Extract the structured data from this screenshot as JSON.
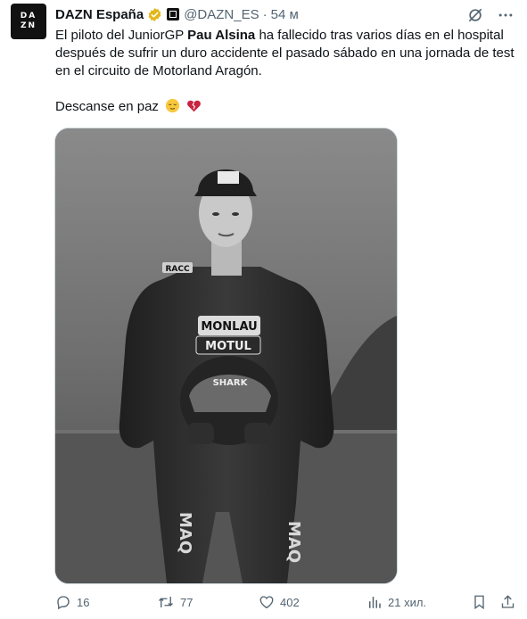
{
  "author": {
    "name": "DAZN España",
    "handle": "@DAZN_ES",
    "time": "54 м",
    "avatar_text": [
      "DA",
      "ZN"
    ]
  },
  "tweet": {
    "p1_a": "El piloto del JuniorGP ",
    "p1_bold": "Pau Alsina",
    "p1_b": " ha fallecido tras varios días en el hospital después de sufrir un duro accidente el pasado sábado en una jornada de test en el circuito de Motorland Aragón.",
    "p2": "Descanse en paz"
  },
  "media": {
    "sponsors": [
      "MONLAU",
      "MOTUL",
      "SHARK",
      "RACC",
      "MAQ"
    ]
  },
  "actions": {
    "replies": "16",
    "retweets": "77",
    "likes": "402",
    "views": "21 хил."
  },
  "icons": {
    "verified": "verified-badge-icon",
    "grok": "grok-icon",
    "more": "more-icon",
    "reply": "reply-icon",
    "retweet": "retweet-icon",
    "like": "heart-icon",
    "views": "views-icon",
    "bookmark": "bookmark-icon",
    "share": "share-icon"
  },
  "colors": {
    "text": "#0f1419",
    "secondary": "#536471",
    "verified_gold": "#e2b719"
  }
}
